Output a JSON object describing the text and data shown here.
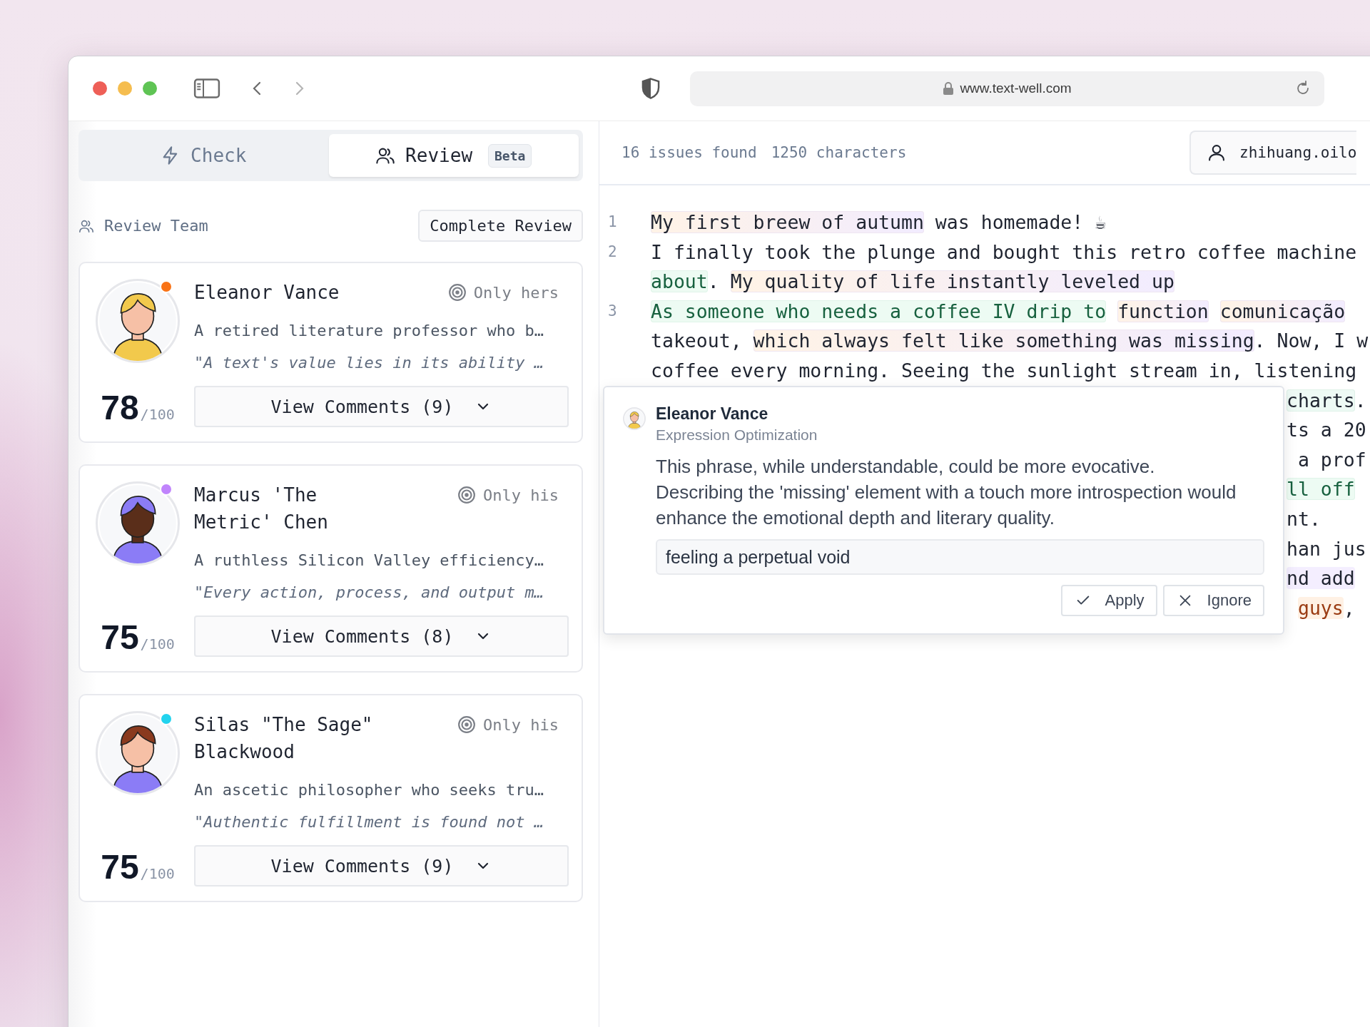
{
  "browser": {
    "url": "www.text-well.com"
  },
  "tabs": [
    {
      "label": "Check",
      "selected": false
    },
    {
      "label": "Review",
      "selected": true,
      "badge": "Beta"
    }
  ],
  "review_team": {
    "title": "Review Team",
    "button": "Complete Review"
  },
  "reviewers": [
    {
      "name": "Eleanor Vance",
      "scope": "Only hers",
      "description": "A retired literature professor who b…",
      "quote": "\"A text's value lies in its ability …",
      "score": "78",
      "score_max": "/100",
      "comments_button": "View Comments (9)",
      "color": "#f97316"
    },
    {
      "name": "Marcus 'The Metric' Chen",
      "scope": "Only his",
      "description": "A ruthless Silicon Valley efficiency…",
      "quote": "\"Every action, process, and output m…",
      "score": "75",
      "score_max": "/100",
      "comments_button": "View Comments (8)",
      "color": "#c084fc"
    },
    {
      "name": "Silas \"The Sage\" Blackwood",
      "scope": "Only his",
      "description": "An ascetic philosopher who seeks tru…",
      "quote": "\"Authentic fulfillment is found not …",
      "score": "75",
      "score_max": "/100",
      "comments_button": "View Comments (9)",
      "color": "#22d3ee"
    }
  ],
  "editor": {
    "issues": "16 issues found",
    "characters": "1250 characters",
    "user": "zhihuang.oilo",
    "lines": [
      {
        "number": "1",
        "rows": [
          {
            "kind": "full",
            "segments": [
              {
                "text": "My first breew of autumn",
                "kind": "warm"
              },
              {
                "text": " was homemade! ☕",
                "kind": "plain"
              }
            ]
          }
        ]
      },
      {
        "number": "2",
        "rows": [
          {
            "kind": "full",
            "segments": [
              {
                "text": "I finally took the plunge and bought this retro coffee machine",
                "kind": "plain"
              }
            ]
          },
          {
            "kind": "full",
            "segments": [
              {
                "text": "about",
                "kind": "green"
              },
              {
                "text": ". ",
                "kind": "plain"
              },
              {
                "text": "My quality of life instantly leveled up",
                "kind": "warm"
              }
            ]
          }
        ]
      },
      {
        "number": "3",
        "rows": [
          {
            "kind": "full",
            "segments": [
              {
                "text": "As someone who needs a coffee IV drip to",
                "kind": "green"
              },
              {
                "text": "function",
                "kind": "warm",
                "spaced": true
              },
              {
                "text": "comunicação",
                "kind": "warm",
                "spaced": true
              }
            ]
          },
          {
            "kind": "full",
            "segments": [
              {
                "text": "takeout, ",
                "kind": "plain"
              },
              {
                "text": "which always felt like something was missing",
                "kind": "warm"
              },
              {
                "text": ". Now, I w",
                "kind": "plain"
              }
            ]
          },
          {
            "kind": "full",
            "segments": [
              {
                "text": "coffee every morning. Seeing the sunlight stream in, listening",
                "kind": "plain"
              }
            ]
          },
          {
            "kind": "partial",
            "segments": [
              {
                "text": "charts",
                "kind": "mint"
              },
              {
                "text": ".",
                "kind": "plain"
              }
            ]
          },
          {
            "kind": "partial",
            "segments": [
              {
                "text": "ts a 20",
                "kind": "plain"
              }
            ]
          },
          {
            "kind": "partial",
            "segments": [
              {
                "text": " a prof",
                "kind": "plain"
              }
            ]
          },
          {
            "kind": "partial",
            "segments": [
              {
                "text": "ll off",
                "kind": "green"
              }
            ]
          },
          {
            "kind": "partial",
            "segments": [
              {
                "text": "nt.",
                "kind": "plain"
              }
            ]
          },
          {
            "kind": "partial",
            "segments": [
              {
                "text": "han jus",
                "kind": "plain"
              }
            ]
          },
          {
            "kind": "partial",
            "segments": [
              {
                "text": "nd add",
                "kind": "violet"
              }
            ]
          },
          {
            "kind": "partial",
            "segments": [
              {
                "text": "guys",
                "kind": "orange",
                "spaced": true
              },
              {
                "text": ",",
                "kind": "plain"
              }
            ]
          }
        ]
      }
    ]
  },
  "comment": {
    "reviewer": "Eleanor Vance",
    "category": "Expression Optimization",
    "message": "This phrase, while understandable, could be more evocative. Describing the 'missing' element with a touch more introspection would enhance the emotional depth and literary quality.",
    "suggestion": "feeling a perpetual void",
    "buttons": [
      {
        "label": "Apply",
        "kind": "apply"
      },
      {
        "label": "Ignore",
        "kind": "ignore"
      }
    ]
  }
}
